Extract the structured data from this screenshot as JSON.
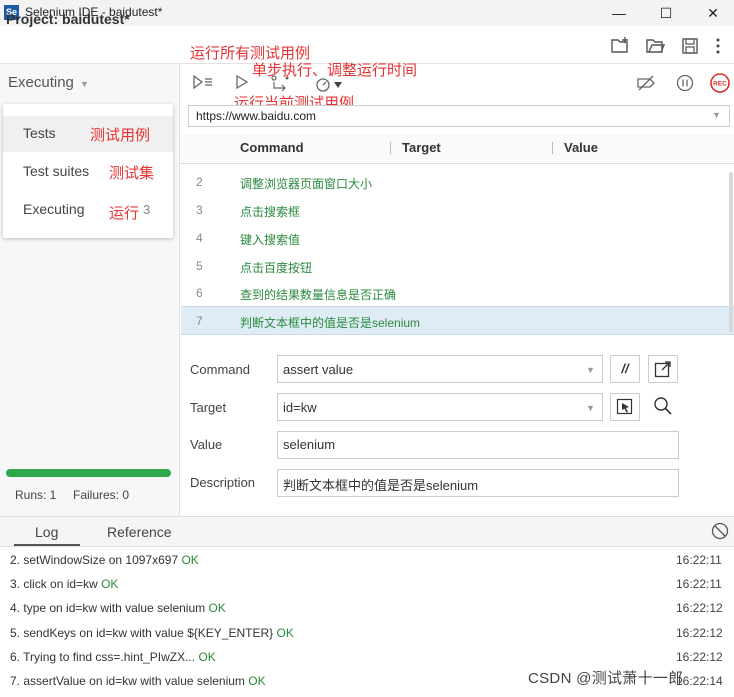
{
  "window": {
    "title": "Selenium IDE - baidutest*",
    "logo_text": "Se",
    "minimize": "—",
    "maximize": "☐",
    "close": "✕"
  },
  "header": {
    "project_label": "Project:",
    "project_name": "baidutest*"
  },
  "left_panel": {
    "dropdown_label": "Executing",
    "menu": [
      {
        "label": "Tests",
        "annotation": "测试用例"
      },
      {
        "label": "Test suites",
        "annotation": "测试集"
      },
      {
        "label": "Executing",
        "annotation": "运行",
        "badge": "3"
      }
    ],
    "progress_percent": 100,
    "progress_color": "#2ea84a",
    "runs_label": "Runs: 1",
    "failures_label": "Failures: 0"
  },
  "annotations": {
    "run_all": "运行所有测试用例",
    "step_speed": "单步执行、调整运行时间",
    "run_current": "运行当前测试用例"
  },
  "toolbar": {
    "rec_label": "REC"
  },
  "url": {
    "value": "https://www.baidu.com"
  },
  "table": {
    "columns": [
      "Command",
      "Target",
      "Value"
    ],
    "rows": [
      {
        "num": "2",
        "command": "调整浏览器页面窗口大小"
      },
      {
        "num": "3",
        "command": "点击搜索框"
      },
      {
        "num": "4",
        "command": "键入搜索值"
      },
      {
        "num": "5",
        "command": "点击百度按钮"
      },
      {
        "num": "6",
        "command": "查到的结果数量信息是否正确"
      },
      {
        "num": "7",
        "command": "判断文本框中的值是否是selenium"
      }
    ]
  },
  "editor": {
    "command_label": "Command",
    "command_value": "assert value",
    "comment_btn": "//",
    "target_label": "Target",
    "target_value": "id=kw",
    "value_label": "Value",
    "value_value": "selenium",
    "description_label": "Description",
    "description_value": "判断文本框中的值是否是selenium"
  },
  "log": {
    "tabs": [
      "Log",
      "Reference"
    ],
    "entries": [
      {
        "n": "2.",
        "text": "setWindowSize on 1097x697",
        "status": "OK",
        "time": "16:22:11"
      },
      {
        "n": "3.",
        "text": "click on id=kw",
        "status": "OK",
        "time": "16:22:11"
      },
      {
        "n": "4.",
        "text": "type on id=kw with value selenium",
        "status": "OK",
        "time": "16:22:12"
      },
      {
        "n": "5.",
        "text": "sendKeys on id=kw with value ${KEY_ENTER}",
        "status": "OK",
        "time": "16:22:12"
      },
      {
        "n": "6.",
        "text": "Trying to find css=.hint_PIwZX...",
        "status": "OK",
        "time": "16:22:12"
      },
      {
        "n": "7.",
        "text": "assertValue on id=kw with value selenium",
        "status": "OK",
        "time": "16:22:14"
      }
    ],
    "watermark": "CSDN @测试萧十一郎"
  },
  "colors": {
    "accent_green": "#2a8a3e",
    "annotation_red": "#e63232",
    "selected_row": "#e0ecf5",
    "rec_red": "#d9302c"
  }
}
